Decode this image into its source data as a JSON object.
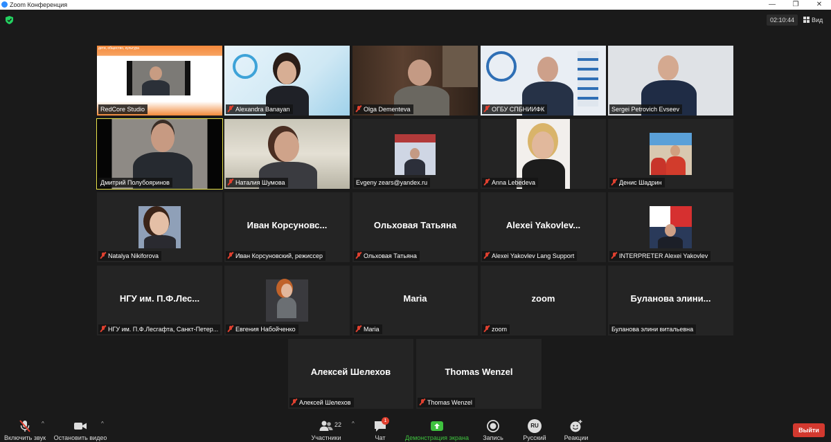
{
  "window": {
    "title": "Zoom Конференция",
    "controls": [
      "—",
      "❐",
      "✕"
    ]
  },
  "topbar": {
    "timer": "02:10:44",
    "view_label": "Вид"
  },
  "tiles": [
    {
      "label": "RedCore Studio",
      "muted": false,
      "banner": "дети, общество, культура"
    },
    {
      "label": "Alexandra Banayan",
      "muted": true
    },
    {
      "label": "Olga Dementeva",
      "muted": true
    },
    {
      "label": "ОГБУ СПБНИИФК",
      "muted": true
    },
    {
      "label": "Sergei Petrovich Evseev",
      "muted": false
    },
    {
      "label": "Дмитрий Полубояринов",
      "muted": false,
      "active": true
    },
    {
      "label": "Наталия Шумова",
      "muted": true
    },
    {
      "label": "Evgeny zears@yandex.ru",
      "muted": false
    },
    {
      "label": "Anna Lebedeva",
      "muted": true
    },
    {
      "label": "Денис Шадрин",
      "muted": true
    },
    {
      "label": "Natalya Nikiforova",
      "muted": true
    },
    {
      "label": "Иван Корсуновский, режиссер",
      "muted": true,
      "big_name": "Иван Корсуновс..."
    },
    {
      "label": "Ольховая Татьяна",
      "muted": true,
      "big_name": "Ольховая Татьяна"
    },
    {
      "label": "Alexei Yakovlev Lang Support",
      "muted": true,
      "big_name": "Alexei Yakovlev..."
    },
    {
      "label": "INTERPRETER Alexei Yakovlev",
      "muted": true
    },
    {
      "label": "НГУ им. П.Ф.Лесгафта, Санкт-Петер...",
      "muted": true,
      "big_name": "НГУ им. П.Ф.Лес..."
    },
    {
      "label": "Евгения Набойченко",
      "muted": true
    },
    {
      "label": "Maria",
      "muted": true,
      "big_name": "Maria"
    },
    {
      "label": "zoom",
      "muted": true,
      "big_name": "zoom"
    },
    {
      "label": "Буланова элини витальевна",
      "muted": false,
      "big_name": "Буланова элини..."
    },
    {
      "label": "Алексей Шелехов",
      "muted": true,
      "big_name": "Алексей Шелехов"
    },
    {
      "label": "Thomas Wenzel",
      "muted": true,
      "big_name": "Thomas Wenzel"
    }
  ],
  "toolbar": {
    "unmute_label": "Включить звук",
    "stop_video_label": "Остановить видео",
    "participants_label": "Участники",
    "participants_count": "22",
    "chat_label": "Чат",
    "chat_badge": "1",
    "share_label": "Демонстрация экрана",
    "record_label": "Запись",
    "language_label": "Русский",
    "language_code": "RU",
    "reactions_label": "Реакции",
    "leave_label": "Выйти"
  },
  "colors": {
    "background": "#1a1a1a",
    "tile": "#242424",
    "active_border": "#e9e34a",
    "muted_icon": "#e0402f",
    "share_green": "#3fc23f",
    "leave_red": "#d3392f"
  }
}
